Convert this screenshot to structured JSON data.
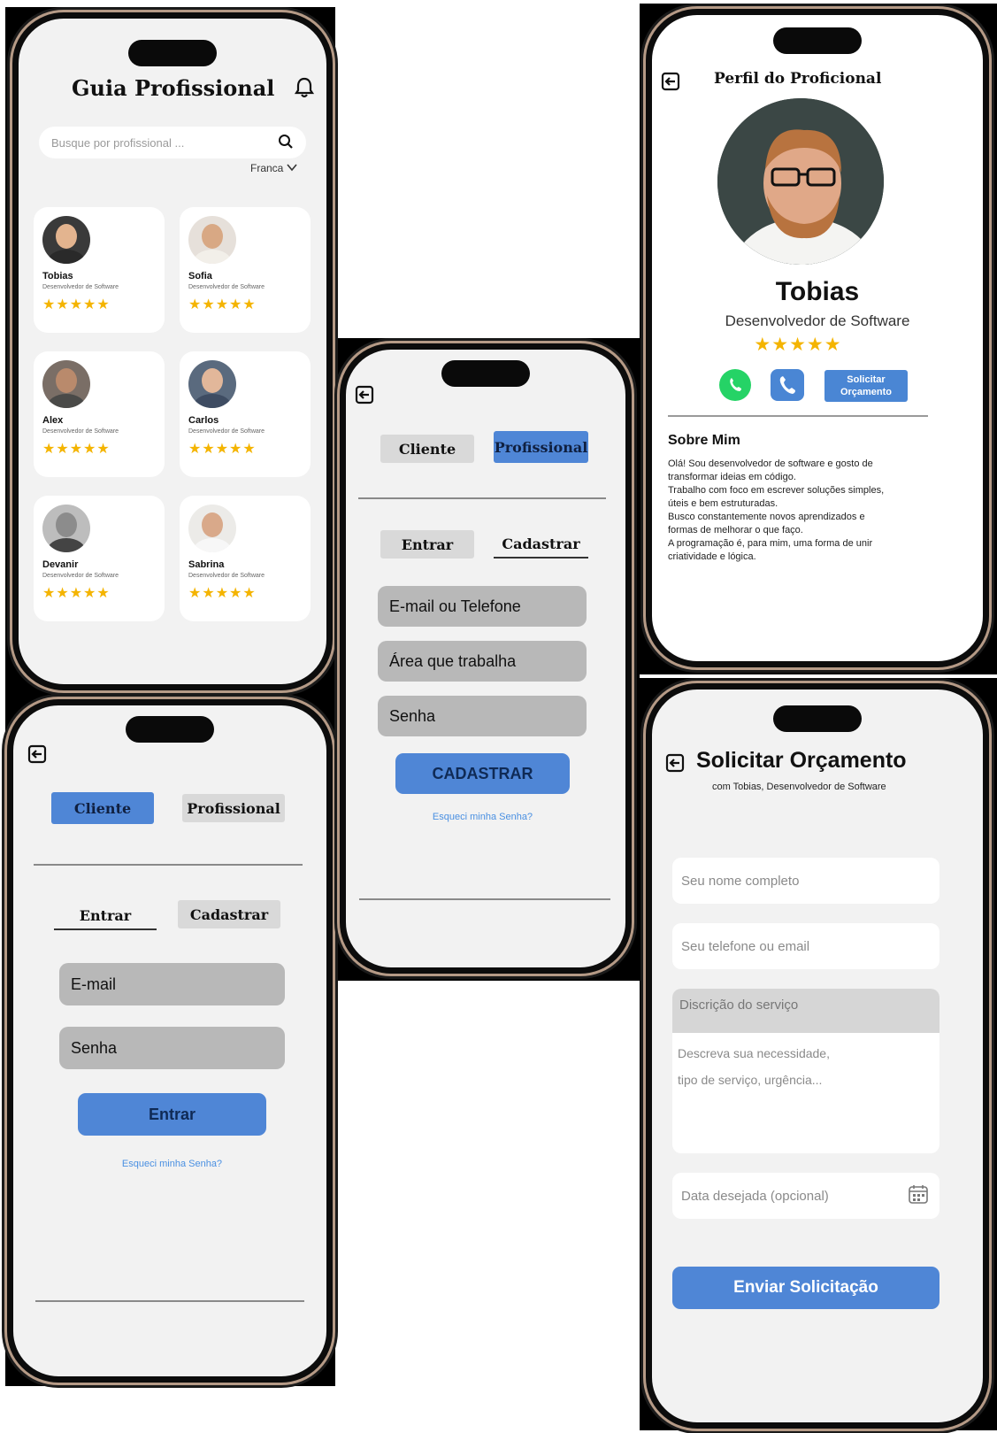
{
  "home": {
    "title": "Guia Profissional",
    "search_placeholder": "Busque por profissional ...",
    "city": "Franca",
    "stars": "★★★★★",
    "professionals": [
      {
        "name": "Tobias",
        "role": "Desenvolvedor de Software"
      },
      {
        "name": "Sofia",
        "role": "Desenvolvedor de Software"
      },
      {
        "name": "Alex",
        "role": "Desenvolvedor de Software"
      },
      {
        "name": "Carlos",
        "role": "Desenvolvedor de Software"
      },
      {
        "name": "Devanir",
        "role": "Desenvolvedor de Software"
      },
      {
        "name": "Sabrina",
        "role": "Desenvolvedor de Software"
      }
    ]
  },
  "register": {
    "tab_client": "Cliente",
    "tab_professional": "Profissional",
    "tab_login": "Entrar",
    "tab_signup": "Cadastrar",
    "field_email_phone": "E-mail ou Telefone",
    "field_area": "Área que trabalha",
    "field_password": "Senha",
    "submit": "CADASTRAR",
    "forgot": "Esqueci minha Senha?"
  },
  "login": {
    "tab_client": "Cliente",
    "tab_professional": "Profissional",
    "tab_login": "Entrar",
    "tab_signup": "Cadastrar",
    "field_email": "E-mail",
    "field_password": "Senha",
    "submit": "Entrar",
    "forgot": "Esqueci minha Senha?"
  },
  "profile": {
    "header": "Perfil do Proficional",
    "name": "Tobias",
    "role": "Desenvolvedor de Software",
    "stars": "★★★★★",
    "quote_button_line1": "Solicitar",
    "quote_button_line2": "Orçamento",
    "about_title": "Sobre Mim",
    "about_lines": [
      "Olá! Sou desenvolvedor de software e gosto de",
      "transformar ideias em código.",
      " Trabalho com foco em escrever soluções simples,",
      "úteis e bem estruturadas.",
      " Busco constantemente novos aprendizados e",
      "formas de melhorar o que faço.",
      " A programação é, para mim, uma forma de unir",
      "criatividade e lógica."
    ]
  },
  "quote": {
    "title": "Solicitar Orçamento",
    "subtitle": "com Tobias, Desenvolvedor de Software",
    "name_placeholder": "Seu nome completo",
    "contact_placeholder": "Seu telefone ou email",
    "desc_label": "Discrição do serviço",
    "desc_placeholder_1": "Descreva sua necessidade,",
    "desc_placeholder_2": "tipo de serviço, urgência...",
    "date_placeholder": "Data desejada (opcional)",
    "submit": "Enviar Solicitação"
  },
  "colors": {
    "accent": "#4f86d6",
    "star": "#f4b400",
    "whatsapp": "#25d366",
    "phone_bg": "#f2f2f2",
    "field_gray": "#b8b8b8"
  }
}
